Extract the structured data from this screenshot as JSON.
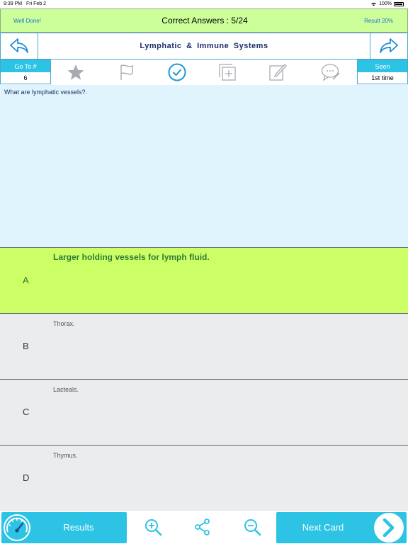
{
  "status_bar": {
    "time": "9:39 PM",
    "date": "Fri Feb 2",
    "battery": "100%"
  },
  "top_bar": {
    "left_label": "Well Done!",
    "title": "Correct Answers : 5/24",
    "right_label": "Result 20%"
  },
  "nav": {
    "title": "Lymphatic & Immune Systems"
  },
  "toolbar": {
    "goto_label": "Go To #",
    "goto_value": "6",
    "seen_label": "Seen",
    "seen_value": "1st time",
    "icons": [
      "star-icon",
      "flag-icon",
      "check-circle-icon",
      "add-card-icon",
      "edit-icon",
      "comment-icon"
    ]
  },
  "question": {
    "text": "What are lymphatic vessels?."
  },
  "answers": [
    {
      "letter": "A",
      "text": "Larger holding vessels for lymph fluid.",
      "selected": true
    },
    {
      "letter": "B",
      "text": "Thorax.",
      "selected": false
    },
    {
      "letter": "C",
      "text": "Lacteals.",
      "selected": false
    },
    {
      "letter": "D",
      "text": "Thymus.",
      "selected": false
    }
  ],
  "bottom_bar": {
    "results_label": "Results",
    "next_label": "Next Card"
  },
  "colors": {
    "accent": "#2cc3e5",
    "selected_bg": "#ccff66",
    "top_bar_bg": "#ccff99",
    "question_bg": "#dff4fd",
    "answer_bg": "#eaecee"
  }
}
